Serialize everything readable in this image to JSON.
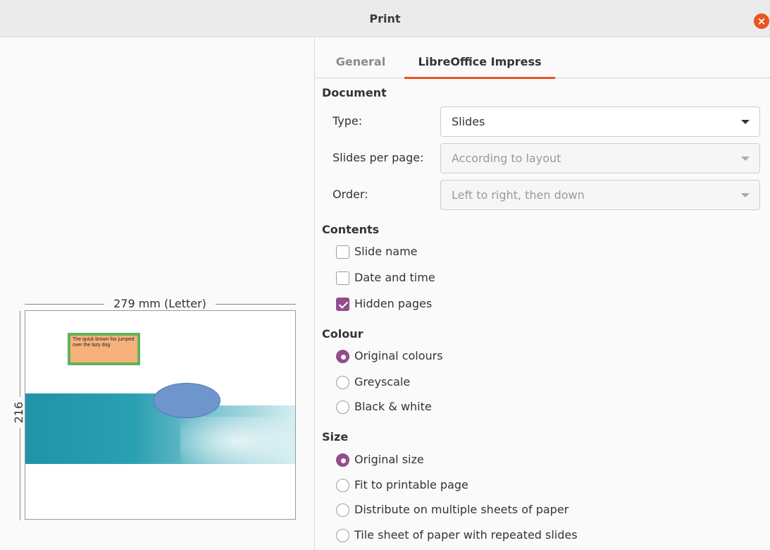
{
  "window": {
    "title": "Print",
    "close_icon": "close-icon",
    "close_glyph": "×"
  },
  "preview": {
    "width_label": "279 mm (Letter)",
    "height_label": "216 mm",
    "slide": {
      "textbox_text": "The quick brown fox jumped over the lazy dog"
    }
  },
  "tabs": [
    {
      "label": "General",
      "active": false
    },
    {
      "label": "LibreOffice Impress",
      "active": true
    }
  ],
  "document": {
    "heading": "Document",
    "type": {
      "label": "Type:",
      "value": "Slides",
      "enabled": true
    },
    "slides_per_page": {
      "label": "Slides per page:",
      "value": "According to layout",
      "enabled": false
    },
    "order": {
      "label": "Order:",
      "value": "Left to right, then down",
      "enabled": false
    }
  },
  "contents": {
    "heading": "Contents",
    "items": [
      {
        "label": "Slide name",
        "checked": false
      },
      {
        "label": "Date and time",
        "checked": false
      },
      {
        "label": "Hidden pages",
        "checked": true
      }
    ]
  },
  "colour": {
    "heading": "Colour",
    "options": [
      {
        "label": "Original colours",
        "selected": true
      },
      {
        "label": "Greyscale",
        "selected": false
      },
      {
        "label": "Black & white",
        "selected": false
      }
    ]
  },
  "size": {
    "heading": "Size",
    "options": [
      {
        "label": "Original size",
        "selected": true
      },
      {
        "label": "Fit to printable page",
        "selected": false
      },
      {
        "label": "Distribute on multiple sheets of paper",
        "selected": false
      },
      {
        "label": "Tile sheet of paper with repeated slides",
        "selected": false
      }
    ]
  },
  "colors": {
    "accent": "#e95420",
    "check": "#924d8b"
  }
}
